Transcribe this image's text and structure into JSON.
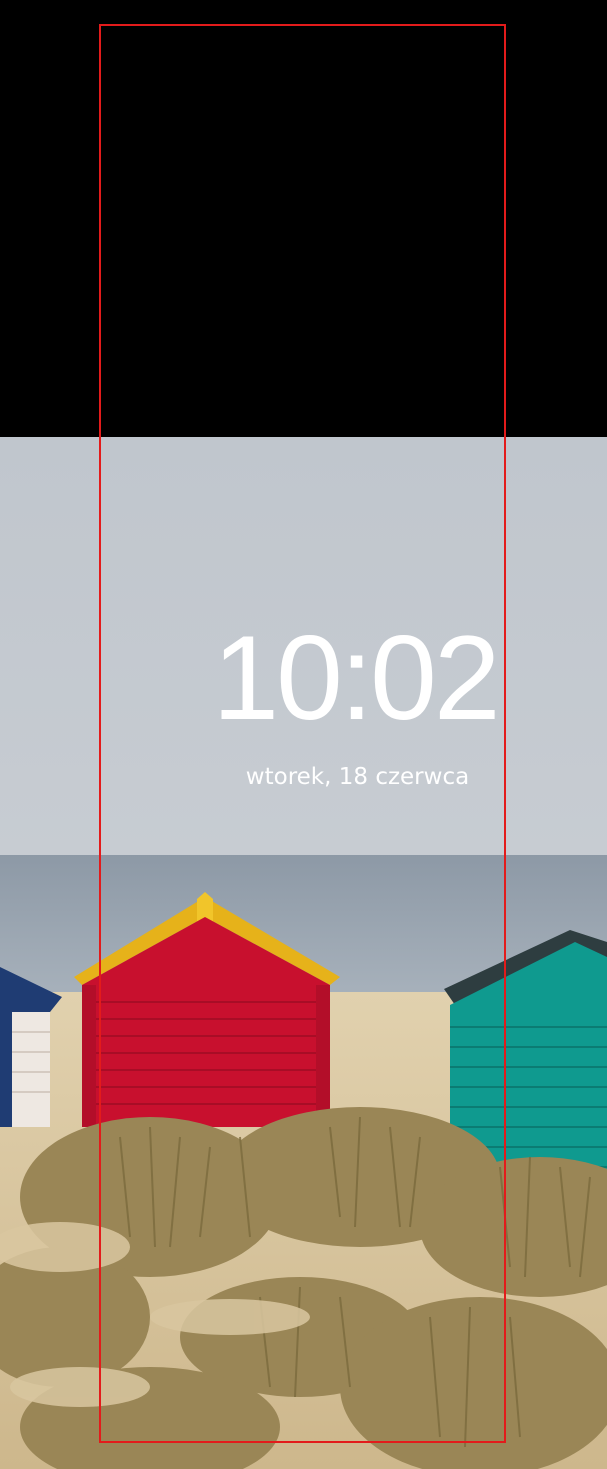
{
  "lockscreen": {
    "time": "10:02",
    "date": "wtorek, 18 czerwca"
  },
  "wallpaper": {
    "description_icon": "beach-huts-wallpaper",
    "colors": {
      "sky": "#c3c8cf",
      "sea": "#8e9aa6",
      "sand": "#dcc9a3",
      "red_hut": "#c8102e",
      "yellow_roof": "#e6b21a",
      "teal_hut": "#0f9a8f",
      "grass": "#8f7a4a"
    }
  },
  "overlay": {
    "frame_color": "#e31b1b"
  }
}
